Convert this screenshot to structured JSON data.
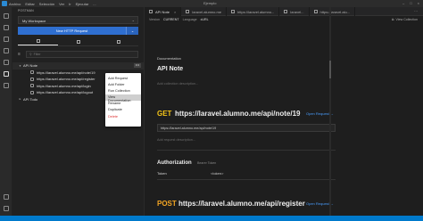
{
  "window": {
    "menus": [
      "Archivo",
      "Editar",
      "Selección",
      "Ver",
      "Ir",
      "Ejecutar",
      "..."
    ],
    "center_title": "Ejemplo"
  },
  "sidebar": {
    "title": "POSTMAN",
    "workspace": "My Workspace",
    "new_request_label": "New HTTP Request",
    "filter_placeholder": "Filter",
    "tree": [
      {
        "type": "folder",
        "label": "API Note",
        "expanded": true
      },
      {
        "type": "item",
        "label": "https://laravel.alumno.me/api/note/19"
      },
      {
        "type": "item",
        "label": "https://laravel.alumno.me/api/register"
      },
      {
        "type": "item",
        "label": "https://laravel.alumno.me/api/login"
      },
      {
        "type": "item",
        "label": "https://laravel.alumno.me/api/logout"
      },
      {
        "type": "folder",
        "label": "API Todo",
        "expanded": false
      }
    ],
    "more_button": "•••"
  },
  "context_menu": {
    "items": [
      "Add Request",
      "Add Folder",
      "Run Collection",
      "View Documentation",
      "Rename",
      "Duplicate",
      "Delete"
    ],
    "highlighted": "View Documentation",
    "danger": "Delete"
  },
  "tabs": [
    {
      "label": "API Note",
      "active": true
    },
    {
      "label": "laravel.alumno.me",
      "active": false
    },
    {
      "label": "https://laravel.alumno...",
      "active": false
    },
    {
      "label": "laravel...",
      "active": false
    },
    {
      "label": "https://laravel.alu...",
      "active": false
    }
  ],
  "toolbar": {
    "version_label": "Version",
    "version_value": "CURRENT",
    "language_label": "Language",
    "language_value": "cURL",
    "view_collection": "View Collection"
  },
  "doc": {
    "section_label": "Documentation",
    "title": "API Note",
    "collection_desc_placeholder": "Add collection description...",
    "requests": [
      {
        "method": "GET",
        "method_color": "#f5c518",
        "url": "https://laravel.alumno.me/api/note/19",
        "open_request": "Open Request →",
        "url_box": "https://laravel.alumno.me/api/note/19",
        "desc_placeholder": "Add request description..."
      },
      {
        "method": "POST",
        "method_color": "#f5a623",
        "url": "https://laravel.alumno.me/api/register",
        "open_request": "Open Request →"
      }
    ],
    "auth": {
      "heading": "Authorization",
      "sub": "Bearer Token",
      "token_label": "Token",
      "token_value": "<token>"
    }
  },
  "colors": {
    "accent": "#2f6fd0",
    "link": "#4a9eff",
    "status_bar": "#007acc"
  }
}
